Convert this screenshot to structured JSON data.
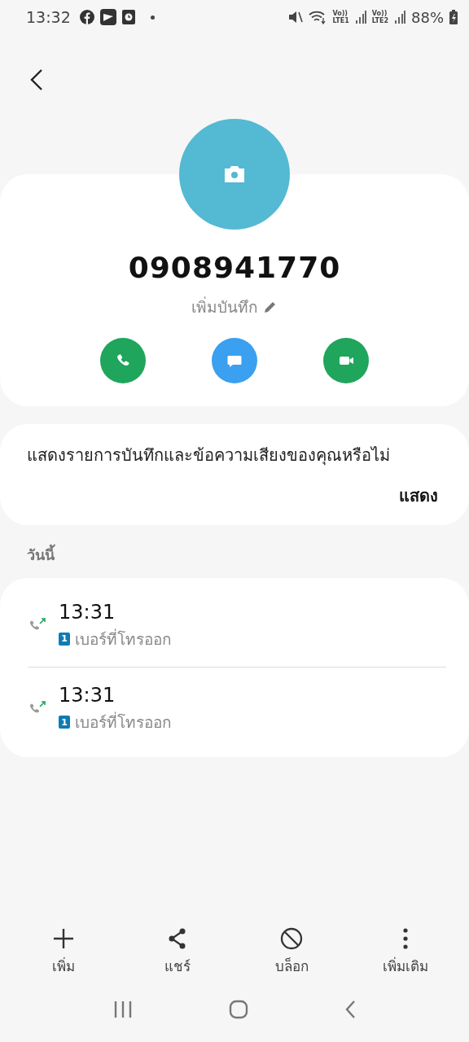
{
  "status_bar": {
    "time": "13:32",
    "notification_icons": [
      {
        "kind": "facebook"
      },
      {
        "kind": "app"
      },
      {
        "kind": "clock"
      }
    ],
    "sim_labels": [
      {
        "top": "Vo))",
        "bottom": "LTE1"
      },
      {
        "top": "Vo))",
        "bottom": "LTE2"
      }
    ],
    "battery": "88%"
  },
  "contact": {
    "number": "0908941770",
    "note_link": "เพิ่มบันทึก"
  },
  "quick_actions": [
    {
      "kind": "call"
    },
    {
      "kind": "message"
    },
    {
      "kind": "video"
    }
  ],
  "prompt": {
    "text": "แสดงรายการบันทึกและข้อความเสียงของคุณหรือไม่",
    "action": "แสดง"
  },
  "history": {
    "heading": "วันนี้",
    "calls": [
      {
        "kind": "outgoing",
        "time": "13:31",
        "sim": "1",
        "label": "เบอร์ที่โทรออก"
      },
      {
        "kind": "outgoing",
        "time": "13:31",
        "sim": "1",
        "label": "เบอร์ที่โทรออก"
      }
    ]
  },
  "bottom_actions": [
    {
      "kind": "add",
      "label": "เพิ่ม"
    },
    {
      "kind": "share",
      "label": "แชร์"
    },
    {
      "kind": "block",
      "label": "บล็อก"
    },
    {
      "kind": "more",
      "label": "เพิ่มเติม"
    }
  ],
  "nav_bar": [
    {
      "kind": "recents"
    },
    {
      "kind": "home"
    },
    {
      "kind": "back"
    }
  ]
}
